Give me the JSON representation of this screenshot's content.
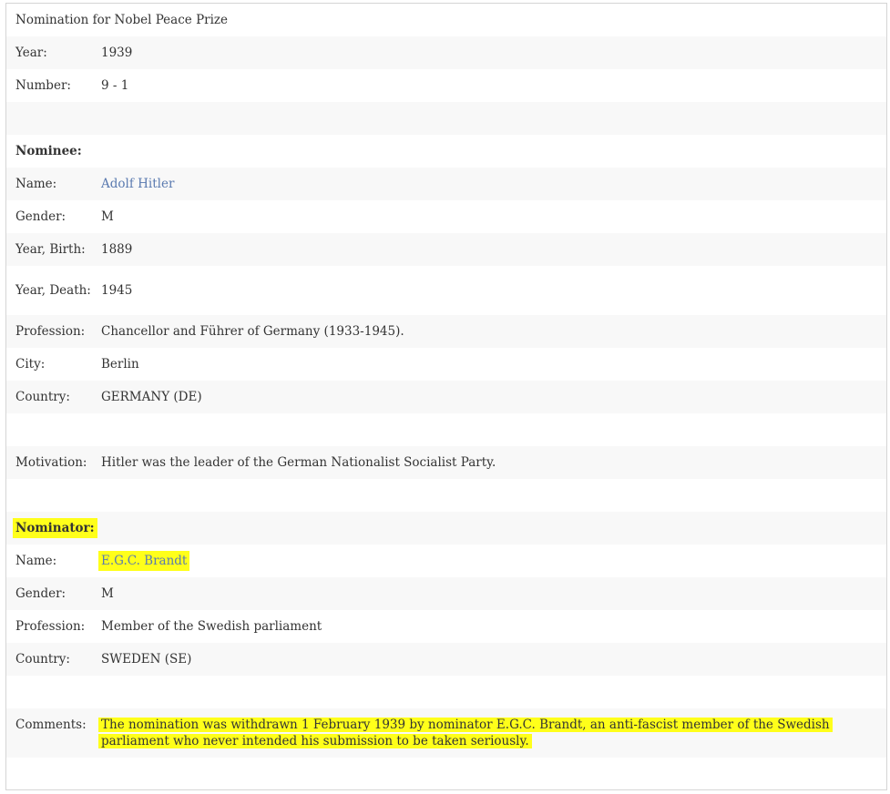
{
  "title": "Nomination for Nobel Peace Prize",
  "year": {
    "label": "Year:",
    "value": "1939"
  },
  "number": {
    "label": "Number:",
    "value": "9 - 1"
  },
  "nominee": {
    "heading": "Nominee:",
    "name": {
      "label": "Name:",
      "value": "Adolf Hitler"
    },
    "gender": {
      "label": "Gender:",
      "value": "M"
    },
    "birth": {
      "label": "Year, Birth:",
      "value": "1889"
    },
    "death": {
      "label": "Year, Death:",
      "value": "1945"
    },
    "profession": {
      "label": "Profession:",
      "value": "Chancellor and Führer of Germany (1933-1945)."
    },
    "city": {
      "label": "City:",
      "value": "Berlin"
    },
    "country": {
      "label": "Country:",
      "value": "GERMANY (DE)"
    }
  },
  "motivation": {
    "label": "Motivation:",
    "value": "Hitler was the leader of the German Nationalist Socialist Party."
  },
  "nominator": {
    "heading": "Nominator:",
    "name": {
      "label": "Name:",
      "value": "E.G.C. Brandt"
    },
    "gender": {
      "label": "Gender:",
      "value": "M"
    },
    "profession": {
      "label": "Profession:",
      "value": "Member of the Swedish parliament"
    },
    "country": {
      "label": "Country:",
      "value": "SWEDEN (SE)"
    }
  },
  "comments": {
    "label": "Comments:",
    "value": "The nomination was withdrawn 1 February 1939 by nominator E.G.C. Brandt, an anti-fascist member of the Swedish parliament who never intended his submission to be taken seriously."
  },
  "colors": {
    "link": "#5a7ab0",
    "highlight": "#ffff1a",
    "stripe": "#f8f8f8",
    "text": "#333333"
  }
}
